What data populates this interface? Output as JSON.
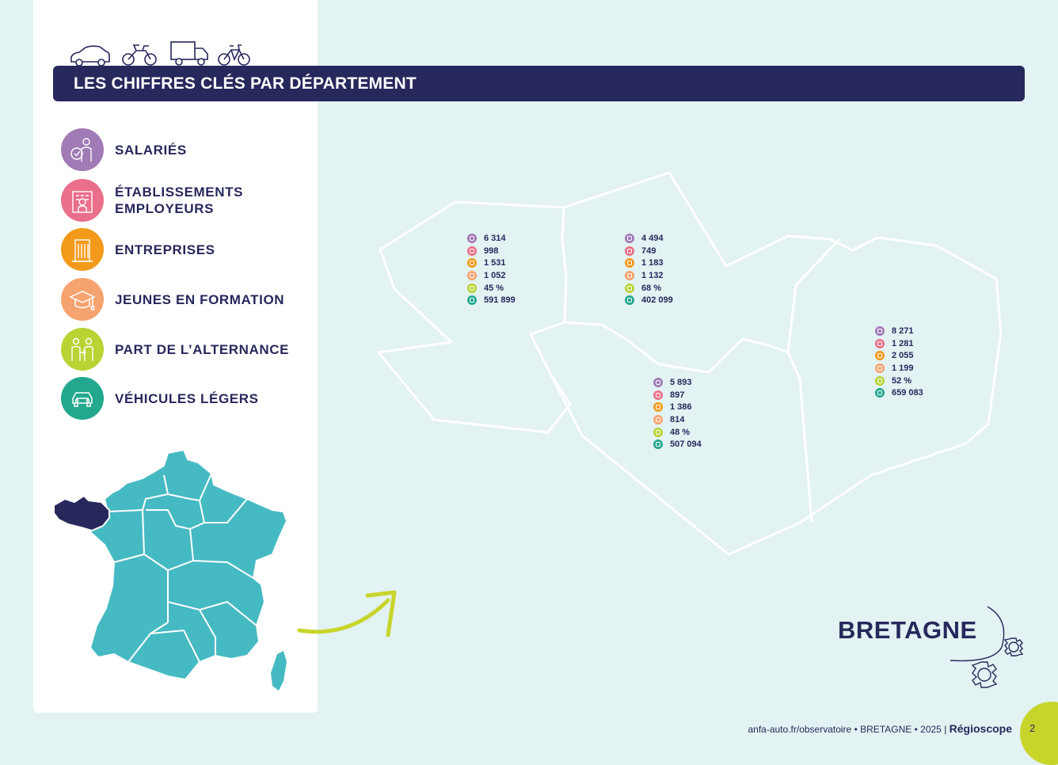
{
  "header": {
    "title": "LES CHIFFRES CLÉS PAR DÉPARTEMENT"
  },
  "legend": [
    {
      "label": "SALARIÉS",
      "color": "#a07bb5",
      "icon": "employee-icon"
    },
    {
      "label": "ÉTABLISSEMENTS EMPLOYEURS",
      "color": "#ea6f8a",
      "icon": "building-icon"
    },
    {
      "label": "ENTREPRISES",
      "color": "#f39a1b",
      "icon": "office-tower-icon"
    },
    {
      "label": "JEUNES EN FORMATION",
      "color": "#f7a36f",
      "icon": "graduation-cap-icon"
    },
    {
      "label": "PART DE L’ALTERNANCE",
      "color": "#b9d334",
      "icon": "alternance-icon"
    },
    {
      "label": "VÉHICULES LÉGERS",
      "color": "#23a88e",
      "icon": "car-icon"
    }
  ],
  "departments": [
    {
      "id": "finistere",
      "values": [
        "6 314",
        "998",
        "1 531",
        "1 052",
        "45 %",
        "591 899"
      ]
    },
    {
      "id": "cotes-darmor",
      "values": [
        "4 494",
        "749",
        "1 183",
        "1 132",
        "68 %",
        "402 099"
      ]
    },
    {
      "id": "ille-et-vilaine",
      "values": [
        "8 271",
        "1 281",
        "2 055",
        "1 199",
        "52 %",
        "659 083"
      ]
    },
    {
      "id": "morbihan",
      "values": [
        "5 893",
        "897",
        "1 386",
        "814",
        "48 %",
        "507 094"
      ]
    }
  ],
  "region": {
    "name": "BRETAGNE"
  },
  "footer": {
    "url": "anfa-auto.fr/observatoire",
    "region": "BRETAGNE",
    "year": "2025",
    "brand": "Régioscope",
    "page": "2"
  },
  "colors": {
    "navy": "#27285c",
    "teal_map": "#46bac3",
    "background": "#e3f2f2",
    "arrow": "#c7d52b"
  }
}
